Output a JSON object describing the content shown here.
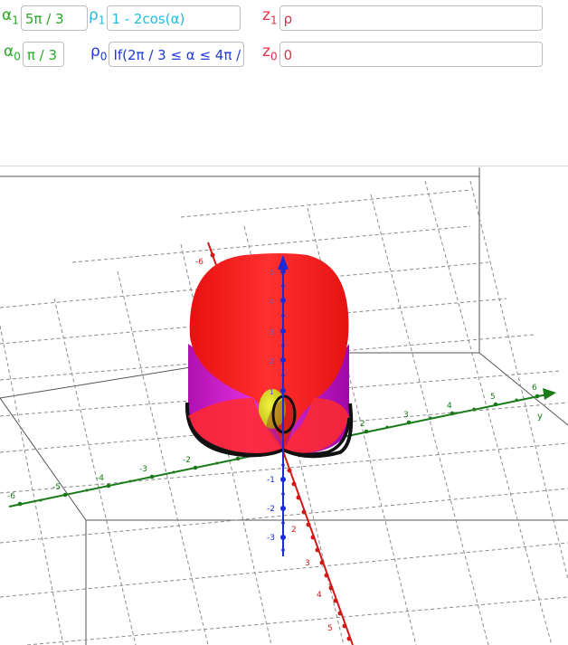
{
  "inputs": [
    {
      "id": "alpha1",
      "sym": "α",
      "sub": "1",
      "value": "5π / 3",
      "color": "#28a828"
    },
    {
      "id": "rho1",
      "sym": "ρ",
      "sub": "1",
      "value": "1 - 2cos(α)",
      "color": "#1fbce0"
    },
    {
      "id": "z1",
      "sym": "z",
      "sub": "1",
      "value": "ρ",
      "color": "#e0304a"
    },
    {
      "id": "alpha0",
      "sym": "α",
      "sub": "0",
      "value": "π / 3",
      "color": "#28a828"
    },
    {
      "id": "rho0",
      "sym": "ρ",
      "sub": "0",
      "value": "If(2π / 3 ≤ α ≤ 4π /",
      "color": "#1f3ad8"
    },
    {
      "id": "z0",
      "sym": "z",
      "sub": "0",
      "value": "0",
      "color": "#e0304a"
    }
  ],
  "axes": {
    "colors": {
      "x": "#d01a1a",
      "y": "#1a7a1a",
      "z": "#1a2ad8"
    },
    "y_label": "y",
    "x_ticks": [
      "-6",
      "2",
      "3",
      "4",
      "5"
    ],
    "y_ticks": [
      "-6",
      "-5",
      "-4",
      "-3",
      "-2",
      "-1",
      "2",
      "3",
      "4",
      "5",
      "6"
    ],
    "z_ticks_pos": [
      "5",
      "4",
      "3",
      "2",
      "1"
    ],
    "z_ticks_neg": [
      "-1",
      "-2",
      "-3"
    ]
  },
  "surface_colors": {
    "top": "#ff2020",
    "side": "#d020d0",
    "inner": "#e0e020",
    "rim": "#111111"
  }
}
